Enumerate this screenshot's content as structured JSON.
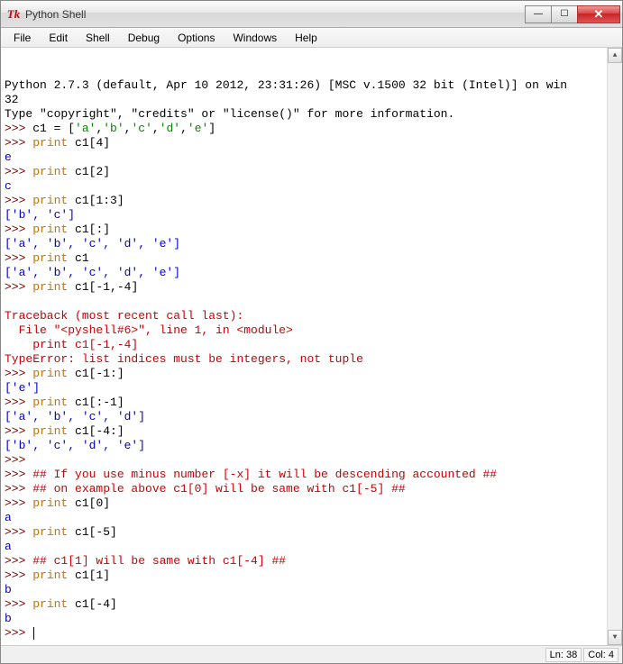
{
  "window": {
    "title": "Python Shell",
    "icon_label": "Tk"
  },
  "menu": {
    "items": [
      "File",
      "Edit",
      "Shell",
      "Debug",
      "Options",
      "Windows",
      "Help"
    ]
  },
  "status": {
    "line": "Ln: 38",
    "col": "Col: 4"
  },
  "shell": {
    "banner1": "Python 2.7.3 (default, Apr 10 2012, 23:31:26) [MSC v.1500 32 bit (Intel)] on win",
    "banner2": "32",
    "banner3": "Type \"copyright\", \"credits\" or \"license()\" for more information.",
    "prompt": ">>>",
    "lines": [
      {
        "t": "assign",
        "lhs": " c1 ",
        "eq": "= [",
        "strs": [
          "'a'",
          "'b'",
          "'c'",
          "'d'",
          "'e'"
        ],
        "tail": "]"
      },
      {
        "t": "print",
        "kw": "print",
        "rest": " c1[4]"
      },
      {
        "t": "out",
        "text": "e"
      },
      {
        "t": "print",
        "kw": "print",
        "rest": " c1[2]"
      },
      {
        "t": "out",
        "text": "c"
      },
      {
        "t": "print",
        "kw": "print",
        "rest": " c1[1:3]"
      },
      {
        "t": "out",
        "text": "['b', 'c']"
      },
      {
        "t": "print",
        "kw": "print",
        "rest": " c1[:]"
      },
      {
        "t": "out",
        "text": "['a', 'b', 'c', 'd', 'e']"
      },
      {
        "t": "print",
        "kw": "print",
        "rest": " c1"
      },
      {
        "t": "out",
        "text": "['a', 'b', 'c', 'd', 'e']"
      },
      {
        "t": "print",
        "kw": "print",
        "rest": " c1[-1,-4]"
      },
      {
        "t": "blank"
      },
      {
        "t": "err",
        "text": "Traceback (most recent call last):"
      },
      {
        "t": "err",
        "text": "  File \"<pyshell#6>\", line 1, in <module>"
      },
      {
        "t": "err",
        "text": "    print c1[-1,-4]"
      },
      {
        "t": "err",
        "text": "TypeError: list indices must be integers, not tuple"
      },
      {
        "t": "print",
        "kw": "print",
        "rest": " c1[-1:]"
      },
      {
        "t": "out",
        "text": "['e']"
      },
      {
        "t": "print",
        "kw": "print",
        "rest": " c1[:-1]"
      },
      {
        "t": "out",
        "text": "['a', 'b', 'c', 'd']"
      },
      {
        "t": "print",
        "kw": "print",
        "rest": " c1[-4:]"
      },
      {
        "t": "out",
        "text": "['b', 'c', 'd', 'e']"
      },
      {
        "t": "empty_prompt"
      },
      {
        "t": "comment",
        "text": " ## If you use minus number [-x] it will be descending accounted ##"
      },
      {
        "t": "comment",
        "text": " ## on example above c1[0] will be same with c1[-5] ##"
      },
      {
        "t": "print",
        "kw": "print",
        "rest": " c1[0]"
      },
      {
        "t": "out",
        "text": "a"
      },
      {
        "t": "print",
        "kw": "print",
        "rest": " c1[-5]"
      },
      {
        "t": "out",
        "text": "a"
      },
      {
        "t": "comment",
        "text": " ## c1[1] will be same with c1[-4] ##"
      },
      {
        "t": "print",
        "kw": "print",
        "rest": " c1[1]"
      },
      {
        "t": "out",
        "text": "b"
      },
      {
        "t": "print",
        "kw": "print",
        "rest": " c1[-4]"
      },
      {
        "t": "out",
        "text": "b"
      },
      {
        "t": "cursor_prompt"
      }
    ]
  }
}
